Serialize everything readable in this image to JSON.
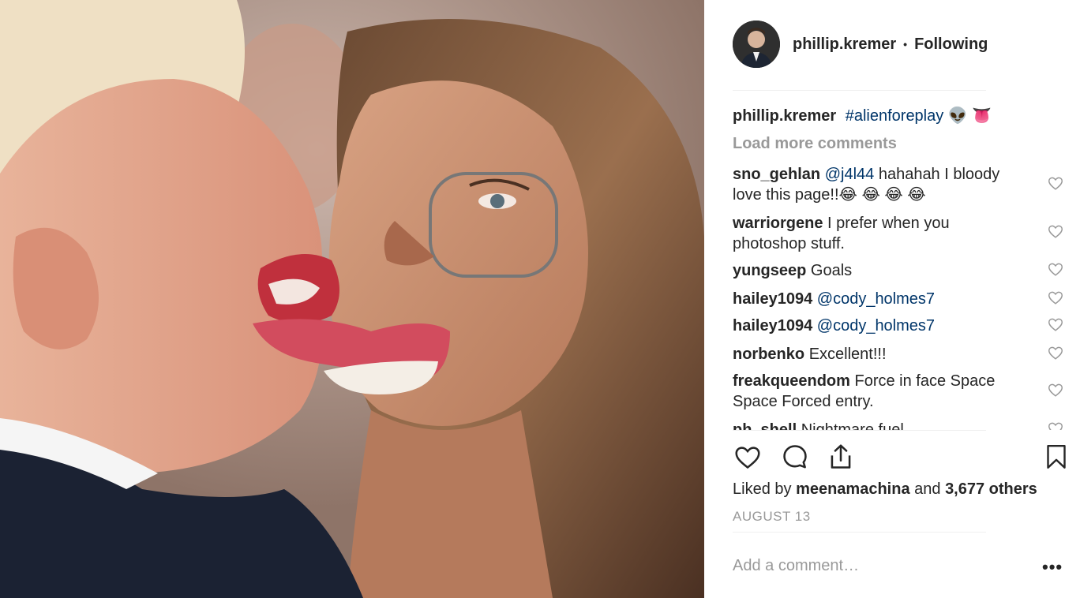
{
  "post": {
    "author": "phillip.kremer",
    "follow_state": "Following",
    "caption_user": "phillip.kremer",
    "caption_text": "#alienforeplay",
    "caption_emoji": "👽 👅",
    "load_more": "Load more comments",
    "comments": [
      {
        "user": "sno_gehlan",
        "mention": "@j4l44",
        "text": " hahahah I bloody love this page!!😂 😂 😂 😂"
      },
      {
        "user": "warriorgene",
        "mention": "",
        "text": " I prefer when you photoshop stuff."
      },
      {
        "user": "yungseep",
        "mention": "",
        "text": " Goals"
      },
      {
        "user": "hailey1094",
        "mention": "@cody_holmes7",
        "text": ""
      },
      {
        "user": "hailey1094",
        "mention": "@cody_holmes7",
        "text": ""
      },
      {
        "user": "norbenko",
        "mention": "",
        "text": " Excellent!!!"
      },
      {
        "user": "freakqueendom",
        "mention": "",
        "text": " Force in face Space Space Forced entry."
      },
      {
        "user": "ph_shell",
        "mention": "",
        "text": " Nightmare fuel"
      }
    ],
    "likes_prefix": "Liked by ",
    "likes_user": "meenamachina",
    "likes_and": " and ",
    "likes_count": "3,677 others",
    "date": "AUGUST 13",
    "add_comment_placeholder": "Add a comment…",
    "more_label": "•••"
  },
  "icons": {
    "like": "heart-icon",
    "comment": "comment-icon",
    "share": "share-icon",
    "save": "bookmark-icon",
    "comment_like": "heart-icon"
  },
  "colors": {
    "text": "#262626",
    "mention": "#003569",
    "muted": "#999999",
    "divider": "#efefef"
  }
}
